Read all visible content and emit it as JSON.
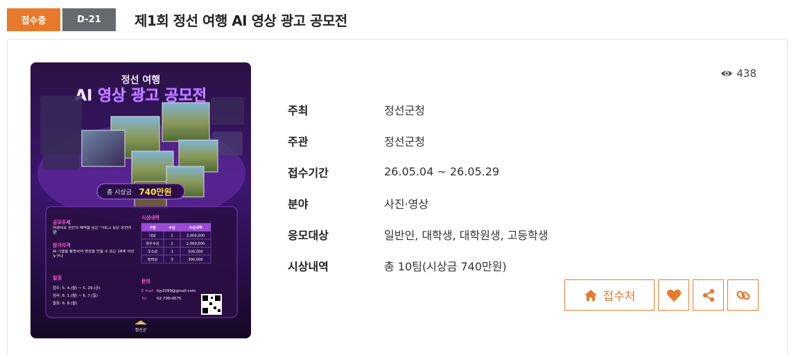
{
  "header": {
    "status_badge": "접수중",
    "dday_badge": "D-21",
    "title": "제1회 정선 여행 AI 영상 광고 공모전"
  },
  "stats": {
    "views": "438"
  },
  "info": [
    {
      "label": "주최",
      "value": "정선군청"
    },
    {
      "label": "주관",
      "value": "정선군청"
    },
    {
      "label": "접수기간",
      "value": "26.05.04 ~ 26.05.29"
    },
    {
      "label": "분야",
      "value": "사진·영상"
    },
    {
      "label": "응모대상",
      "value": "일반인, 대학생, 대학원생, 고등학생"
    },
    {
      "label": "시상내역",
      "value": "총 10팀(시상금 740만원)"
    }
  ],
  "actions": {
    "apply_label": "접수처"
  },
  "poster": {
    "subtitle": "정선 여행",
    "headline": "AI 영상 광고 공모전",
    "prize_label": "총 시상금",
    "prize_amount": "740만원",
    "theme_heading": "공모주제",
    "theme_text": "여행자로 정선의 매력을 담은 '가보고 싶은 정선여행'",
    "eligibility_heading": "참가자격",
    "eligibility_text": "AI 기술을 활용하여 영상을 만들 수 있는 18세 이상 누구나",
    "schedule_heading": "일정",
    "schedule_lines": [
      "접수: 5. 4.(월) ~ 5. 29.(금)",
      "심사: 6. 1.(월) ~ 6. 7.(일)",
      "발표: 6. 8.(월)"
    ],
    "awards_heading": "시상내역",
    "awards_headers": [
      "구분",
      "수상",
      "수상내역"
    ],
    "awards_rows": [
      [
        "대상",
        "1",
        "3,000,000"
      ],
      [
        "최우수상",
        "2",
        "1,000,000"
      ],
      [
        "우수상",
        "3",
        "500,000"
      ],
      [
        "장려상",
        "3",
        "300,000"
      ]
    ],
    "contact_heading": "문의",
    "contact_email_label": "E-mail",
    "contact_email": "kjy2099@gmail.com",
    "contact_tel_label": "Tel.",
    "contact_tel": "02-706-9575",
    "footer_logo": "정선군"
  },
  "colors": {
    "accent": "#e8792a",
    "dday": "#666a6e"
  }
}
